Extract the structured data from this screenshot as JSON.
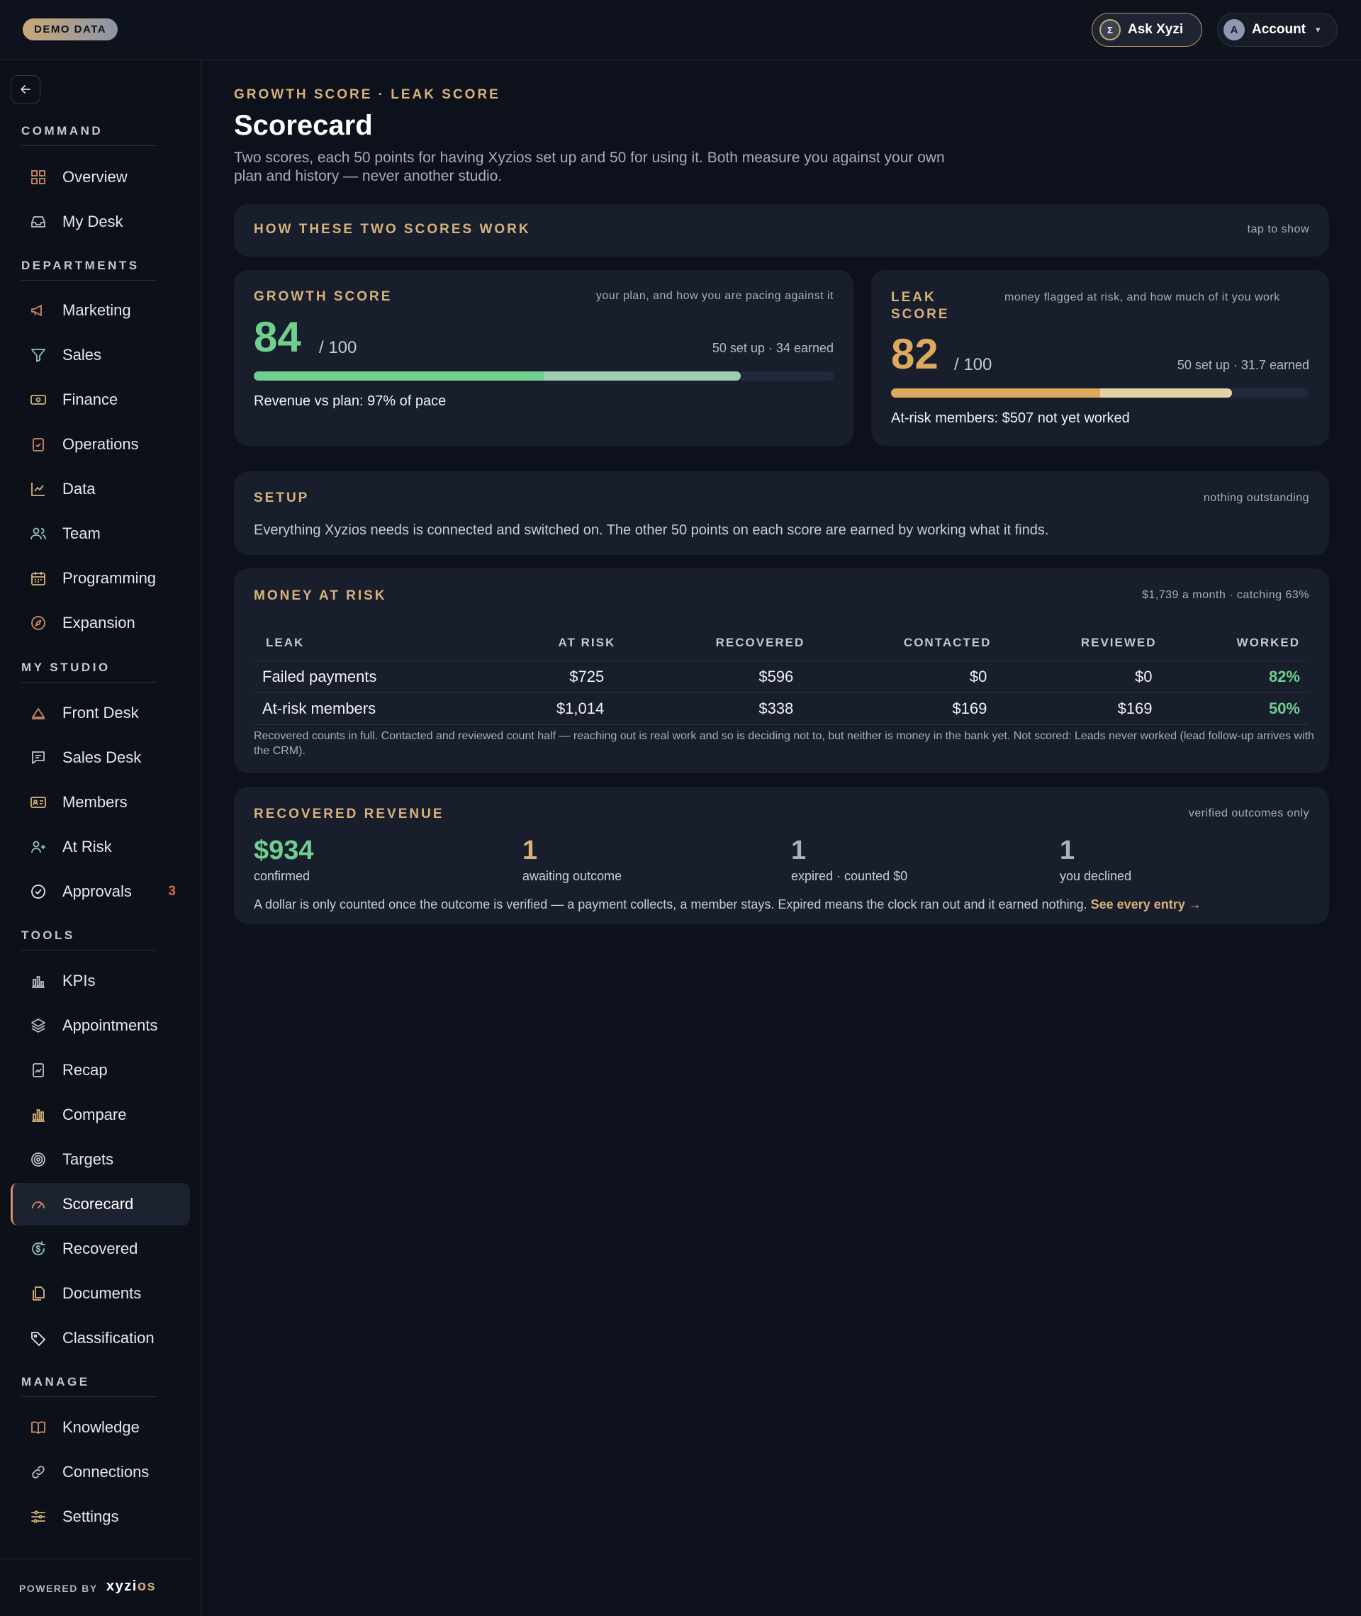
{
  "topbar": {
    "demo_badge": "DEMO DATA",
    "ask_label": "Ask Xyzi",
    "ask_icon_glyph": "Σ",
    "account_label": "Account",
    "account_initial": "A",
    "account_caret": "▾"
  },
  "sidebar": {
    "sections": {
      "command": "COMMAND",
      "departments": "DEPARTMENTS",
      "my_studio": "MY STUDIO",
      "tools": "TOOLS",
      "manage": "MANAGE"
    },
    "items": [
      {
        "label": "Overview",
        "icon": "grid-icon"
      },
      {
        "label": "My Desk",
        "icon": "inbox-icon"
      },
      {
        "label": "Marketing",
        "icon": "megaphone-icon"
      },
      {
        "label": "Sales",
        "icon": "funnel-icon"
      },
      {
        "label": "Finance",
        "icon": "banknote-icon"
      },
      {
        "label": "Operations",
        "icon": "clipboard-check-icon"
      },
      {
        "label": "Data",
        "icon": "line-chart-icon"
      },
      {
        "label": "Team",
        "icon": "users-icon"
      },
      {
        "label": "Programming",
        "icon": "calendar-icon"
      },
      {
        "label": "Expansion",
        "icon": "compass-icon"
      },
      {
        "label": "Front Desk",
        "icon": "bell-icon"
      },
      {
        "label": "Sales Desk",
        "icon": "message-icon"
      },
      {
        "label": "Members",
        "icon": "id-card-icon"
      },
      {
        "label": "At Risk",
        "icon": "user-plus-icon"
      },
      {
        "label": "Approvals",
        "icon": "check-circle-icon",
        "badge": "3"
      },
      {
        "label": "KPIs",
        "icon": "bar-chart-icon"
      },
      {
        "label": "Appointments",
        "icon": "layers-icon"
      },
      {
        "label": "Recap",
        "icon": "file-chart-icon"
      },
      {
        "label": "Compare",
        "icon": "columns-chart-icon"
      },
      {
        "label": "Targets",
        "icon": "target-icon"
      },
      {
        "label": "Scorecard",
        "icon": "gauge-icon",
        "active": true
      },
      {
        "label": "Recovered",
        "icon": "dollar-refresh-icon"
      },
      {
        "label": "Documents",
        "icon": "files-icon"
      },
      {
        "label": "Classification",
        "icon": "tag-icon"
      },
      {
        "label": "Knowledge",
        "icon": "book-icon"
      },
      {
        "label": "Connections",
        "icon": "link-icon"
      },
      {
        "label": "Settings",
        "icon": "sliders-icon"
      }
    ],
    "powered_by": "POWERED BY",
    "logo_main": "xyzi",
    "logo_accent": "os"
  },
  "header": {
    "eyebrow": "GROWTH SCORE · LEAK SCORE",
    "title": "Scorecard",
    "subtitle": "Two scores, each 50 points for having Xyzios set up and 50 for using it. Both measure you against your own plan and history — never another studio."
  },
  "how_it_works": {
    "label": "HOW THESE TWO SCORES WORK",
    "action": "tap to show"
  },
  "growth": {
    "label": "GROWTH SCORE",
    "note": "your plan, and how you are pacing against it",
    "score": "84",
    "out_of": "/ 100",
    "meta": "50 set up · 34 earned",
    "setup_points": 50,
    "earned_points": 34,
    "foot": "Revenue vs plan: 97% of pace",
    "color_setup": "#6fcf8e",
    "color_earned": "#9fcfb0"
  },
  "leak": {
    "label": "LEAK SCORE",
    "note": "money flagged at risk, and how much of it you work",
    "score": "82",
    "out_of": "/ 100",
    "meta": "50 set up · 31.7 earned",
    "setup_points": 50,
    "earned_points": 31.7,
    "foot": "At-risk members: $507 not yet worked",
    "color_setup": "#dca95e",
    "color_earned": "#e3d2a6"
  },
  "setup": {
    "label": "SETUP",
    "note": "nothing outstanding",
    "text": "Everything Xyzios needs is connected and switched on. The other 50 points on each score are earned by working what it finds."
  },
  "money_at_risk": {
    "label": "MONEY AT RISK",
    "note": "$1,739 a month · catching 63%",
    "columns": [
      "LEAK",
      "AT RISK",
      "RECOVERED",
      "CONTACTED",
      "REVIEWED",
      "WORKED"
    ],
    "rows": [
      [
        "Failed payments",
        "$725",
        "$596",
        "$0",
        "$0",
        "82%"
      ],
      [
        "At-risk members",
        "$1,014",
        "$338",
        "$169",
        "$169",
        "50%"
      ]
    ],
    "footnote": "Recovered counts in full. Contacted and reviewed count half — reaching out is real work and so is deciding not to, but neither is money in the bank yet. Not scored: Leads never worked (lead follow-up arrives with the CRM)."
  },
  "recovered_revenue": {
    "label": "RECOVERED REVENUE",
    "note": "verified outcomes only",
    "stats": [
      {
        "value": "$934",
        "label": "confirmed",
        "color": "#6fcf8e"
      },
      {
        "value": "1",
        "label": "awaiting outcome",
        "color": "#d9b27a"
      },
      {
        "value": "1",
        "label": "expired · counted $0",
        "color": "#aab0bd"
      },
      {
        "value": "1",
        "label": "you declined",
        "color": "#aab0bd"
      }
    ],
    "foot": "A dollar is only counted once the outcome is verified — a payment collects, a member stays. Expired means the clock ran out and it earned nothing.",
    "link": "See every entry →"
  }
}
